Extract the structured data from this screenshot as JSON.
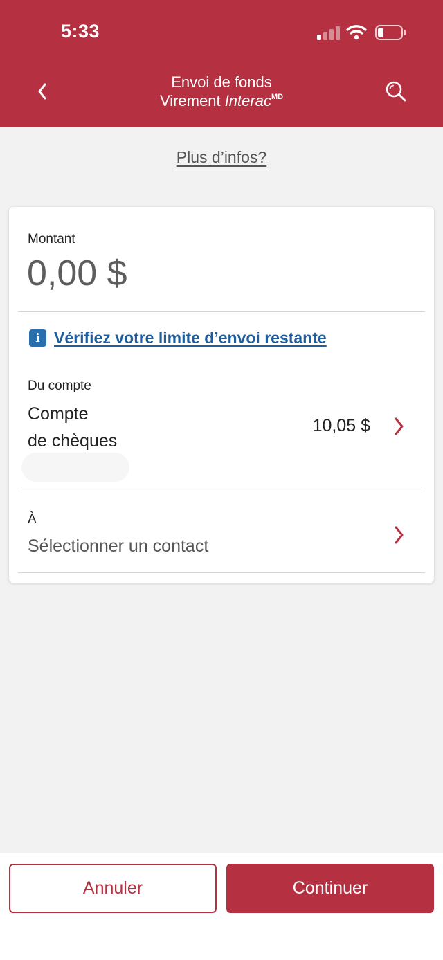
{
  "status_bar": {
    "time": "5:33"
  },
  "header": {
    "title_line1": "Envoi de fonds",
    "title_line2_prefix": "Virement ",
    "title_line2_brand": "Interac",
    "title_line2_sup": "MD",
    "back_icon": "chevron-left-icon",
    "search_icon": "search-icon"
  },
  "more_info_link": "Plus d’infos?",
  "amount": {
    "label": "Montant",
    "value": "0,00 $"
  },
  "limit_link": {
    "icon": "info-icon",
    "icon_glyph": "i",
    "label": "Vérifiez votre limite d’envoi restante"
  },
  "from_account": {
    "label": "Du compte",
    "account_line1": "Compte",
    "account_line2": "de chèques",
    "balance": "10,05 $"
  },
  "to_contact": {
    "label": "À",
    "placeholder": "Sélectionner un contact"
  },
  "footer": {
    "cancel_label": "Annuler",
    "continue_label": "Continuer"
  },
  "colors": {
    "brand": "#b53141",
    "link": "#1f5e9c",
    "info_icon": "#2a6fad",
    "background": "#f2f2f2"
  }
}
